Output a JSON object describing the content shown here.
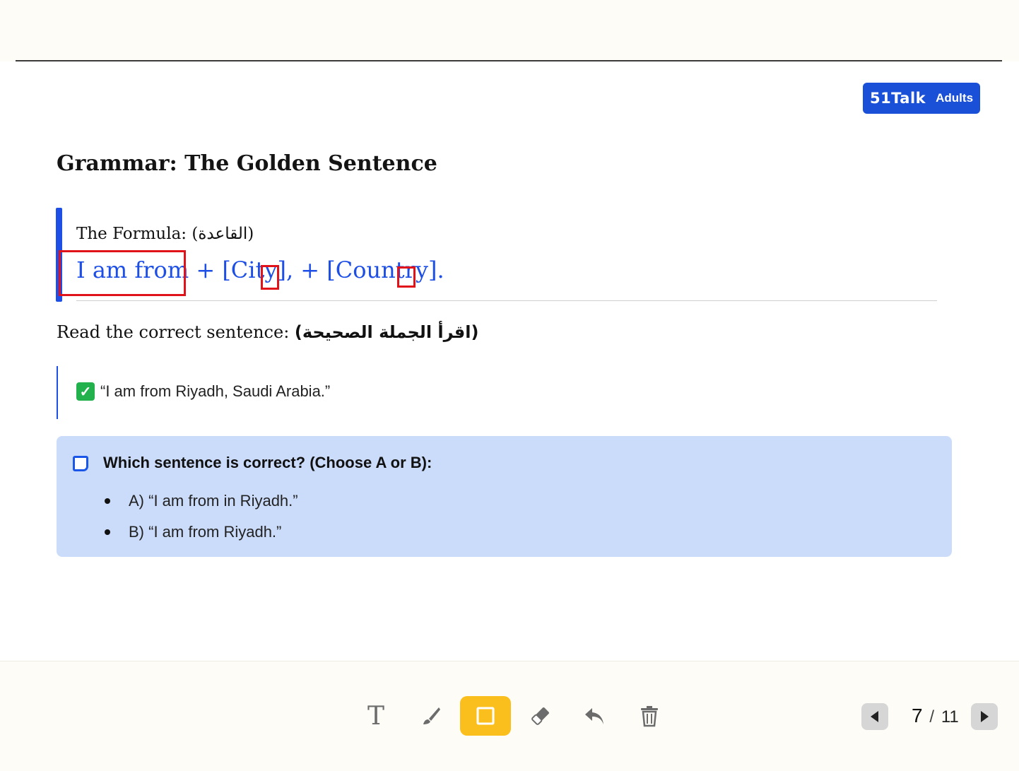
{
  "brand": {
    "name": "51Talk",
    "sub": "Adults",
    "color": "#1a4fd8"
  },
  "title": "Grammar: The Golden Sentence",
  "formula": {
    "label": "The Formula: (القاعدة)",
    "segment_1": "I am from",
    "segment_2": " + [City]",
    "period_1": ",",
    "segment_3": " + [Country]",
    "period_2": ".",
    "color": "#1d4fe6"
  },
  "read": {
    "label": "Read the correct sentence: ",
    "arabic": "(اقرأ الجملة الصحيحة)"
  },
  "example": {
    "icon": "check-mark-icon",
    "text": "“I am from Riyadh, Saudi Arabia.”"
  },
  "question": {
    "icon": "note-icon",
    "text": "Which sentence is correct? (Choose A or B):",
    "options": [
      "A) “I am from in Riyadh.”",
      "B) “I am from Riyadh.”"
    ]
  },
  "toolbar": {
    "tools": [
      "text-tool",
      "brush-tool",
      "rectangle-tool",
      "eraser-tool",
      "undo-tool",
      "delete-tool"
    ],
    "active": "rectangle-tool",
    "active_color": "#fbbf1d"
  },
  "pagination": {
    "current": "7",
    "separator": "/",
    "total": "11"
  }
}
